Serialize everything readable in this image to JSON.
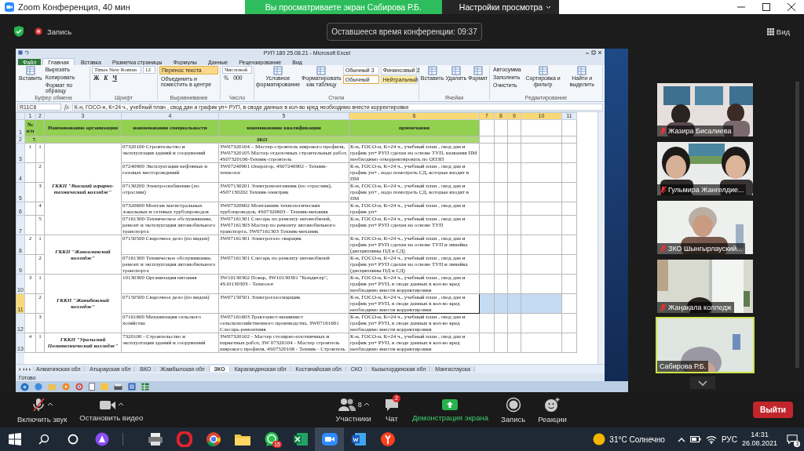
{
  "window": {
    "title": "Zoom Конференция, 40 мин"
  },
  "share_banner": {
    "text": "Вы просматриваете экран Сабирова Р.Б.",
    "settings_button": "Настройки просмотра"
  },
  "meeting_bar": {
    "record_label": "Запись",
    "timer": "Оставшееся время конференции: 09:37",
    "view_button": "Вид"
  },
  "shared_screen": {
    "excel": {
      "title": "РУП 180 25.08.21 - Microsoft Excel",
      "tabs": [
        {
          "label": "Файл",
          "kind": "file",
          "selected": false
        },
        {
          "label": "Главная",
          "kind": "tab",
          "selected": true
        },
        {
          "label": "Вставка",
          "kind": "tab",
          "selected": false
        },
        {
          "label": "Разметка страницы",
          "kind": "tab",
          "selected": false
        },
        {
          "label": "Формулы",
          "kind": "tab",
          "selected": false
        },
        {
          "label": "Данные",
          "kind": "tab",
          "selected": false
        },
        {
          "label": "Рецензирование",
          "kind": "tab",
          "selected": false
        },
        {
          "label": "Вид",
          "kind": "tab",
          "selected": false
        }
      ],
      "ribbon": [
        {
          "label": "Буфер обмена",
          "stacks": [
            [
              {
                "kind": "big",
                "label": "Вставить"
              }
            ],
            [
              {
                "kind": "small",
                "label": "Вырезать",
                "on": false
              },
              {
                "kind": "small",
                "label": "Копировать",
                "on": false
              },
              {
                "kind": "small",
                "label": "Формат по образцу",
                "on": false
              }
            ]
          ]
        },
        {
          "label": "Шрифт",
          "stacks": [
            [
              [
                {
                  "kind": "field",
                  "label": "Times New Roman"
                },
                {
                  "kind": "field",
                  "label": "12"
                }
              ],
              [
                {
                  "kind": "bold",
                  "label": "Ж"
                },
                {
                  "kind": "italic",
                  "label": "К"
                },
                {
                  "kind": "underline",
                  "label": "Ч"
                }
              ]
            ]
          ]
        },
        {
          "label": "Выравнивание",
          "stacks": [
            [
              {
                "kind": "small",
                "label": "Перенос текста",
                "on": true
              },
              {
                "kind": "small",
                "label": "Объединить и поместить в центре",
                "on": false
              }
            ]
          ]
        },
        {
          "label": "Число",
          "stacks": [
            [
              {
                "kind": "field",
                "label": "Числовой"
              },
              [
                {
                  "kind": "glyph",
                  "label": "%"
                },
                {
                  "kind": "glyph",
                  "label": "000"
                }
              ]
            ]
          ]
        },
        {
          "label": "Стили",
          "stacks": [
            [
              {
                "kind": "big",
                "label": "Условное форматирование"
              }
            ],
            [
              {
                "kind": "big",
                "label": "Форматировать как таблицу"
              }
            ],
            [
              [
                {
                  "kind": "style",
                  "label": "Обычный 3",
                  "color": "#ffffff",
                  "selected": false
                },
                {
                  "kind": "style",
                  "label": "Финансовый 2",
                  "color": "#ffffff",
                  "selected": false
                }
              ],
              [
                {
                  "kind": "style",
                  "label": "Обычный",
                  "color": "#ffffff",
                  "selected": true
                },
                {
                  "kind": "style",
                  "label": "Нейтральный",
                  "color": "#ffeb9c",
                  "selected": false
                }
              ]
            ]
          ]
        },
        {
          "label": "Ячейки",
          "stacks": [
            [
              {
                "kind": "big",
                "label": "Вставить"
              }
            ],
            [
              {
                "kind": "big",
                "label": "Удалить"
              }
            ],
            [
              {
                "kind": "big",
                "label": "Формат"
              }
            ]
          ]
        },
        {
          "label": "Редактирование",
          "stacks": [
            [
              {
                "kind": "small",
                "label": "Автосумма",
                "on": false
              },
              {
                "kind": "small",
                "label": "Заполнить",
                "on": false
              },
              {
                "kind": "small",
                "label": "Очистить",
                "on": false
              }
            ],
            [
              {
                "kind": "big",
                "label": "Сортировка и фильтр"
              }
            ],
            [
              {
                "kind": "big",
                "label": "Найти и выделить"
              }
            ]
          ]
        }
      ],
      "name_box": "R11C6",
      "formula_label": "fx",
      "formula": "К-н, ГОСО-н, К=24 ч., учебный план , свод дан и график уп+ РУП,  в своде данных в кол-во кред необходимо внести корректировки",
      "columns": [
        {
          "label": "1",
          "selected": false
        },
        {
          "label": "2",
          "selected": false
        },
        {
          "label": "3",
          "selected": false
        },
        {
          "label": "4",
          "selected": false
        },
        {
          "label": "5",
          "selected": false
        },
        {
          "label": "6",
          "selected": true
        },
        {
          "label": "7",
          "selected": true
        },
        {
          "label": "8",
          "selected": true
        },
        {
          "label": "9",
          "selected": true
        },
        {
          "label": "10",
          "selected": true
        },
        {
          "label": "11",
          "selected": false
        }
      ],
      "header": {
        "row_number": "1",
        "number": "№ п/п",
        "organization": "Наименование организации",
        "specialty": "наименование специальности",
        "qualification": "наименование квалификации",
        "note": "примечания"
      },
      "region": {
        "row_number": "2",
        "number": "7.",
        "name": "ЗКО"
      },
      "groups": [
        {
          "number": "1",
          "organization": "ГККП \"Высший аграрно-технический колледж\"",
          "rows": [
            {
              "row_number": "3",
              "sub": "1",
              "specialty": "07320100 Строительство и эксплуатация зданий и сооружений",
              "qualification": "3W07320104 – Мастер-строитель широкого профиля, 3W07320105 Мастер отделочных строительных работ, 4S07320106-Техник-строитель",
              "note": "К-н, ГОСО-н, К=24 ч., учебный план , свод дан и график уп+ РУП сделан на основе ТУП, названия ПМ необходимо откорректировать по ОПЗП",
              "selected": false
            },
            {
              "row_number": "4",
              "sub": "2",
              "specialty": "07240900 Эксплуатация нефтяных и газовых месторождений",
              "qualification": "3W07240901 Оператор, 4S07240902 - Техник-технолог",
              "note": "К-н, ГОСО-н, К=24 ч., учебный план , свод дан и график уп+ , надо помотреть СД, которые входят в ПМ",
              "selected": false
            },
            {
              "row_number": "5",
              "sub": "3",
              "specialty": "07130200 Электроснабжение (по отраслям)",
              "qualification": "3W07130201 Электромонтажник (по отраслям), 4S07130202 Техник-электрик",
              "note": "К-н, ГОСО-н, К=24 ч., учебный план , свод дан и график уп+ , надо помотреть СД, которые входят в ПМ",
              "selected": false
            },
            {
              "row_number": "6",
              "sub": "4",
              "specialty": "07320600  Монтаж магистральных локальных и сетевых трубопроводов",
              "qualification": "3W07320602  Монтажник технологических трубопроводов, 4S07320603 - Техник-механик",
              "note": "К-н, ГОСО-н, К=24 ч., учебный план , свод дан и график уп+",
              "selected": false
            },
            {
              "row_number": "7",
              "sub": "5",
              "specialty": "07161300-Техническое обслуживание, ремонт и эксплуатация автомобильного транспорта",
              "qualification": "3W07161301 Слесарь по ремонту автомобилей, 3W07161303 Мастер по ремонту автомобильного транспорта, 3W07161303 Техник-механик",
              "note": "К-н, ГОСО-н, К=24 ч., учебный план , свод дан и график уп+ РУП сделан на основе ТУП",
              "selected": false
            }
          ]
        },
        {
          "number": "2",
          "organization": "ГККП \"Жангалинский колледж\"",
          "rows": [
            {
              "row_number": "8",
              "sub": "1",
              "specialty": "07150500 Сварочное дело (по видам)",
              "qualification": "3W07161301 Электрогазо сварщик",
              "note": "К-н, ГОСО-н, К=24 ч., учебный план , свод дан и график уп+ РУП сделан на основе ТУП и линейка (дисциплины ПД и СД)",
              "selected": false
            },
            {
              "row_number": "9",
              "sub": "2",
              "specialty": "07161300 Техническое обслуживание, ремонт и эксплуатация автомобильного транспорта",
              "qualification": "3W07161301 Слесарь по ремонту автомобилей",
              "note": "К-н, ГОСО-н, К=24 ч., учебный план , свод дан и график уп+ РУП сделан на основе ТУП и линейка (дисциплины ПД и СД)",
              "selected": false
            }
          ]
        },
        {
          "number": "3",
          "organization": "ГККП \"Жанибекский колледж\"",
          "rows": [
            {
              "row_number": "10",
              "sub": "1",
              "specialty": "10130300 Организация питания",
              "qualification": "3W10130302 Повар, 3W10130301 \"Кондитер\", 4S10130303 - Технолог",
              "note": "К-н, ГОСО-н, К=24 ч., учебный план , свод дан и график уп+ РУП,  в своде данных в кол-во кред необходимо внести корректировки",
              "selected": false
            },
            {
              "row_number": "11",
              "sub": "2",
              "specialty": "07150500 Сварочное дело (по видам)",
              "qualification": "3W07150501 Электрогазосварщик",
              "note": "К-н, ГОСО-н, К=24 ч., учебный план , свод дан и график уп+ РУП,  в своде данных в кол-во кред необходимо внести корректировки",
              "selected": true
            },
            {
              "row_number": "12",
              "sub": "3",
              "specialty": "07161600 Механизация сельского хозяйства",
              "qualification": "3W07161603 Тракторист-машинист сельскохозяйственного производства, 3W07161601 Слесарь-ремонтник",
              "note": "К-н, ГОСО-н, К=24 ч., учебный план , свод дан и график уп+ РУП,  в своде данных в кол-во кред необходимо внести корректировки",
              "selected": false
            }
          ]
        },
        {
          "number": "4",
          "organization": "ГККП \"Уральский Политехнический колледж\"",
          "rows": [
            {
              "row_number": "13",
              "sub": "1",
              "specialty": "7320100 - Строительство и эксплуатация зданий и сооружений",
              "qualification": "3W07320102 - Мастер столярно-плотничных и паркетных работ, 3W 07320104 - Мастер строитель широкого профиля, 4S07320106 - Техник - Строитель",
              "note": "К-н, ГОСО-н, К=24 ч., учебный план , свод дан и график уп+ РУП,  в своде данных в кол-во кред необходимо внести корректировки",
              "selected": false
            }
          ]
        }
      ],
      "sheets": [
        {
          "label": "Алматинская обл",
          "selected": false
        },
        {
          "label": "Атырауская обл",
          "selected": false
        },
        {
          "label": "ВКО",
          "selected": false
        },
        {
          "label": "Жамбылская обл",
          "selected": false
        },
        {
          "label": "ЗКО",
          "selected": true
        },
        {
          "label": "Карагандинская обл",
          "selected": false
        },
        {
          "label": "Костанайская обл",
          "selected": false
        },
        {
          "label": "СКО",
          "selected": false
        },
        {
          "label": "Кызылординская обл",
          "selected": false
        },
        {
          "label": "Мангистауска",
          "selected": false
        }
      ],
      "status": "Готово"
    }
  },
  "participants": [
    {
      "name": "Жазира Бисалиева",
      "muted": true,
      "selected": false
    },
    {
      "name": "Гульмира Жангелдие...",
      "muted": true,
      "selected": false
    },
    {
      "name": "ЗКО Шынгырлауский...",
      "muted": true,
      "selected": false
    },
    {
      "name": "Жаңақала колледж",
      "muted": true,
      "selected": false
    },
    {
      "name": "Сабирова Р.Б.",
      "muted": false,
      "selected": true
    }
  ],
  "toolbar": {
    "items": [
      {
        "kind": "unmute",
        "label": "Включить звук",
        "caret": true
      },
      {
        "kind": "video",
        "label": "Остановить видео",
        "caret": true
      },
      {
        "kind": "participants",
        "label": "Участники",
        "count": "8",
        "caret": true
      },
      {
        "kind": "chat",
        "label": "Чат",
        "badge": "2",
        "caret": false
      },
      {
        "kind": "share",
        "label": "Демонстрация экрана",
        "caret": false
      },
      {
        "kind": "record",
        "label": "Запись",
        "caret": false
      },
      {
        "kind": "reactions",
        "label": "Реакции",
        "caret": false
      }
    ],
    "leave_button": "Выйти"
  },
  "taskbar": {
    "apps": [
      {
        "kind": "printer",
        "selected": false
      },
      {
        "kind": "opera",
        "selected": false
      },
      {
        "kind": "chrome",
        "selected": false
      },
      {
        "kind": "folder",
        "selected": false
      },
      {
        "kind": "whatsapp",
        "badge": "15",
        "selected": false
      },
      {
        "kind": "excel",
        "selected": false
      },
      {
        "kind": "zoom",
        "selected": true
      },
      {
        "kind": "word",
        "selected": false
      },
      {
        "kind": "yandex",
        "selected": false
      }
    ],
    "weather": "31°C Солнечно",
    "language": "РУС",
    "time": "14:31",
    "date": "26.08.2021",
    "notifications": "3"
  }
}
